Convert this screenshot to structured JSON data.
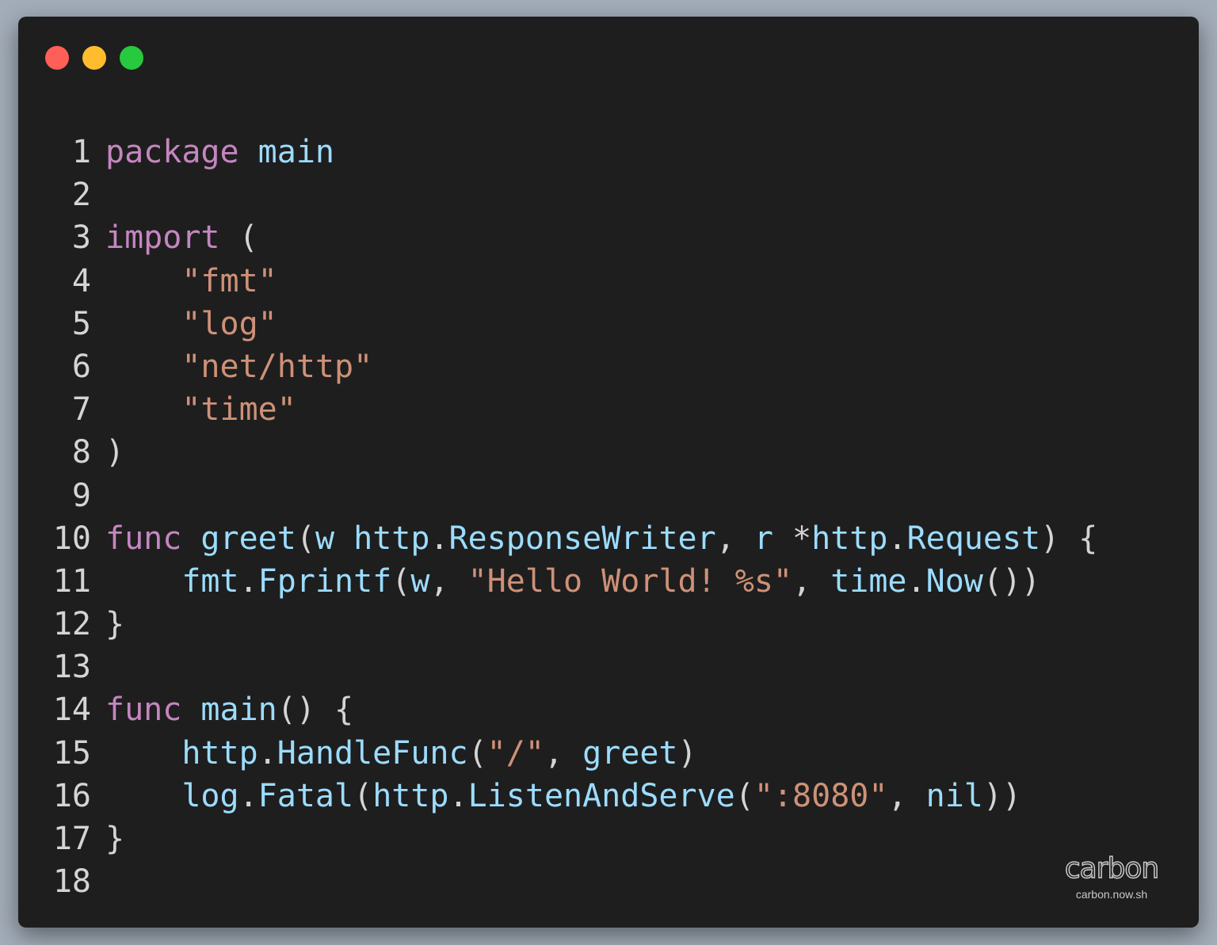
{
  "window": {
    "controls": [
      "close",
      "minimize",
      "maximize"
    ]
  },
  "code": {
    "language": "go",
    "lines": [
      {
        "num": "1",
        "tokens": [
          {
            "t": "package",
            "c": "kw"
          },
          {
            "t": " ",
            "c": "pun"
          },
          {
            "t": "main",
            "c": "id"
          }
        ]
      },
      {
        "num": "2",
        "tokens": []
      },
      {
        "num": "3",
        "tokens": [
          {
            "t": "import",
            "c": "kw"
          },
          {
            "t": " (",
            "c": "pun"
          }
        ]
      },
      {
        "num": "4",
        "tokens": [
          {
            "t": "    ",
            "c": "pun"
          },
          {
            "t": "\"fmt\"",
            "c": "str"
          }
        ]
      },
      {
        "num": "5",
        "tokens": [
          {
            "t": "    ",
            "c": "pun"
          },
          {
            "t": "\"log\"",
            "c": "str"
          }
        ]
      },
      {
        "num": "6",
        "tokens": [
          {
            "t": "    ",
            "c": "pun"
          },
          {
            "t": "\"net/http\"",
            "c": "str"
          }
        ]
      },
      {
        "num": "7",
        "tokens": [
          {
            "t": "    ",
            "c": "pun"
          },
          {
            "t": "\"time\"",
            "c": "str"
          }
        ]
      },
      {
        "num": "8",
        "tokens": [
          {
            "t": ")",
            "c": "pun"
          }
        ]
      },
      {
        "num": "9",
        "tokens": []
      },
      {
        "num": "10",
        "tokens": [
          {
            "t": "func",
            "c": "kw"
          },
          {
            "t": " ",
            "c": "pun"
          },
          {
            "t": "greet",
            "c": "id"
          },
          {
            "t": "(",
            "c": "pun"
          },
          {
            "t": "w",
            "c": "id"
          },
          {
            "t": " ",
            "c": "pun"
          },
          {
            "t": "http",
            "c": "id"
          },
          {
            "t": ".",
            "c": "pun"
          },
          {
            "t": "ResponseWriter",
            "c": "id"
          },
          {
            "t": ", ",
            "c": "pun"
          },
          {
            "t": "r",
            "c": "id"
          },
          {
            "t": " *",
            "c": "pun"
          },
          {
            "t": "http",
            "c": "id"
          },
          {
            "t": ".",
            "c": "pun"
          },
          {
            "t": "Request",
            "c": "id"
          },
          {
            "t": ") {",
            "c": "pun"
          }
        ]
      },
      {
        "num": "11",
        "tokens": [
          {
            "t": "    ",
            "c": "pun"
          },
          {
            "t": "fmt",
            "c": "id"
          },
          {
            "t": ".",
            "c": "pun"
          },
          {
            "t": "Fprintf",
            "c": "id"
          },
          {
            "t": "(",
            "c": "pun"
          },
          {
            "t": "w",
            "c": "id"
          },
          {
            "t": ", ",
            "c": "pun"
          },
          {
            "t": "\"Hello World! %s\"",
            "c": "str"
          },
          {
            "t": ", ",
            "c": "pun"
          },
          {
            "t": "time",
            "c": "id"
          },
          {
            "t": ".",
            "c": "pun"
          },
          {
            "t": "Now",
            "c": "id"
          },
          {
            "t": "())",
            "c": "pun"
          }
        ]
      },
      {
        "num": "12",
        "tokens": [
          {
            "t": "}",
            "c": "pun"
          }
        ]
      },
      {
        "num": "13",
        "tokens": []
      },
      {
        "num": "14",
        "tokens": [
          {
            "t": "func",
            "c": "kw"
          },
          {
            "t": " ",
            "c": "pun"
          },
          {
            "t": "main",
            "c": "id"
          },
          {
            "t": "() {",
            "c": "pun"
          }
        ]
      },
      {
        "num": "15",
        "tokens": [
          {
            "t": "    ",
            "c": "pun"
          },
          {
            "t": "http",
            "c": "id"
          },
          {
            "t": ".",
            "c": "pun"
          },
          {
            "t": "HandleFunc",
            "c": "id"
          },
          {
            "t": "(",
            "c": "pun"
          },
          {
            "t": "\"/\"",
            "c": "str"
          },
          {
            "t": ", ",
            "c": "pun"
          },
          {
            "t": "greet",
            "c": "id"
          },
          {
            "t": ")",
            "c": "pun"
          }
        ]
      },
      {
        "num": "16",
        "tokens": [
          {
            "t": "    ",
            "c": "pun"
          },
          {
            "t": "log",
            "c": "id"
          },
          {
            "t": ".",
            "c": "pun"
          },
          {
            "t": "Fatal",
            "c": "id"
          },
          {
            "t": "(",
            "c": "pun"
          },
          {
            "t": "http",
            "c": "id"
          },
          {
            "t": ".",
            "c": "pun"
          },
          {
            "t": "ListenAndServe",
            "c": "id"
          },
          {
            "t": "(",
            "c": "pun"
          },
          {
            "t": "\":8080\"",
            "c": "str"
          },
          {
            "t": ", ",
            "c": "pun"
          },
          {
            "t": "nil",
            "c": "id"
          },
          {
            "t": "))",
            "c": "pun"
          }
        ]
      },
      {
        "num": "17",
        "tokens": [
          {
            "t": "}",
            "c": "pun"
          }
        ]
      },
      {
        "num": "18",
        "tokens": []
      }
    ]
  },
  "watermark": {
    "logo": "carbon",
    "url": "carbon.now.sh"
  },
  "colors": {
    "background": "#a3adb9",
    "window": "#1e1e1e",
    "keyword": "#c586c0",
    "identifier": "#9cdcfe",
    "string": "#ce9178",
    "punctuation": "#d4d4d4",
    "close": "#ff5f56",
    "minimize": "#ffbd2e",
    "maximize": "#27c93f"
  }
}
